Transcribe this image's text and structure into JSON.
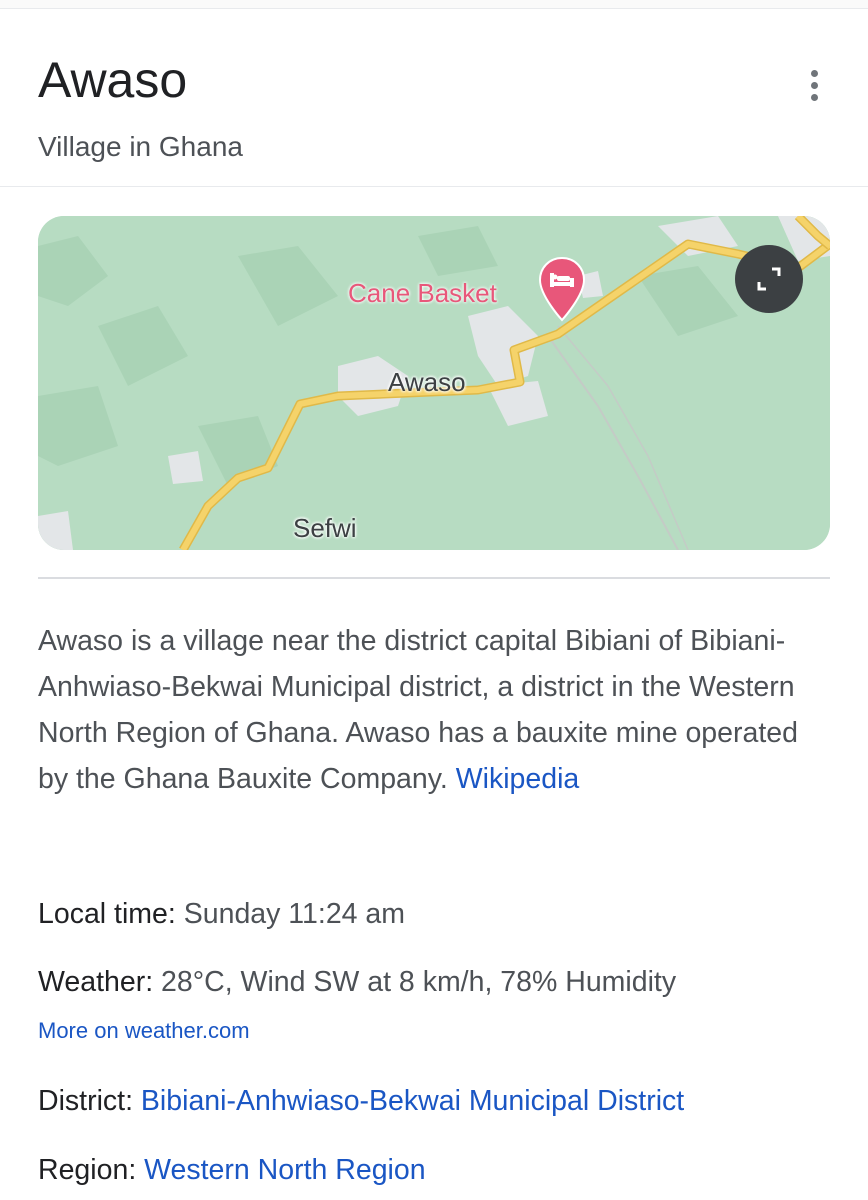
{
  "header": {
    "title": "Awaso",
    "subtitle": "Village in Ghana",
    "more_icon": "more-vert-icon"
  },
  "map": {
    "place_label": "Awaso",
    "poi_label": "Cane Basket",
    "poi_icon": "hotel-bed-icon",
    "nearby_label": "Sefwi",
    "expand_icon": "expand-fullscreen-icon",
    "colors": {
      "land": "#b7dcc2",
      "road": "#f5d36a",
      "road_outline": "#e0b948",
      "urban": "#e3e6e8",
      "poi": "#e8577a"
    }
  },
  "description": {
    "text": "Awaso is a village near the district capital Bibiani of Bibiani-Anhwiaso-Bekwai Municipal district, a district in the Western North Region of Ghana. Awaso has a bauxite mine operated by the Ghana Bauxite Company. ",
    "source_link": "Wikipedia"
  },
  "facts": {
    "local_time": {
      "label": "Local time:",
      "value": " Sunday 11:24 am"
    },
    "weather": {
      "label": "Weather:",
      "value": " 28°C, Wind SW at 8 km/h, 78% Humidity",
      "more_link": "More on weather.com"
    },
    "district": {
      "label": "District:",
      "value": " Bibiani-Anhwiaso-Bekwai Municipal District"
    },
    "region": {
      "label": "Region:",
      "value": " Western North Region"
    }
  },
  "colors": {
    "link": "#1a56c4",
    "text_primary": "#202124",
    "text_secondary": "#4d5156"
  }
}
